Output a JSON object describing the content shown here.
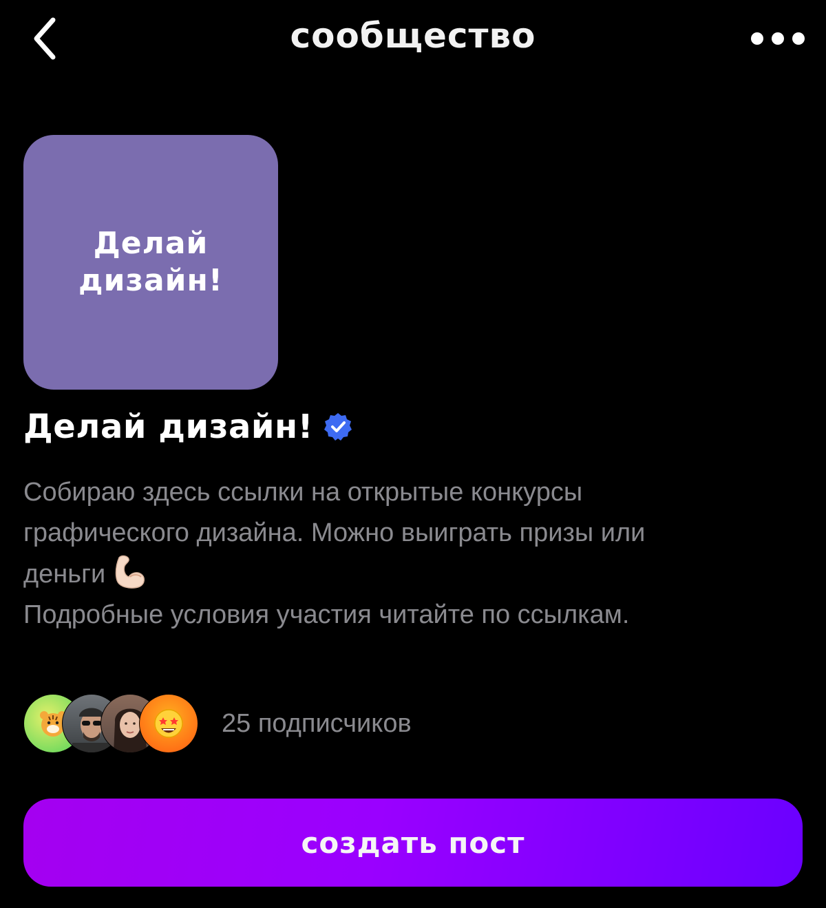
{
  "header": {
    "title": "сообщество",
    "back_icon": "chevron-left-icon",
    "more_icon": "more-dots-icon"
  },
  "community": {
    "cover_text_line1": "Делай",
    "cover_text_line2": "дизайн!",
    "cover_color": "#7b6daf",
    "name": "Делай дизайн!",
    "verified": true,
    "verified_color": "#3e6bf2",
    "description_lines": [
      "Собираю здесь ссылки на открытые конкурсы",
      "графического дизайна. Можно выиграть призы или",
      "деньги",
      "Подробные условия участия читайте по ссылкам."
    ],
    "description_emoji": "flexed-biceps-icon"
  },
  "subscribers": {
    "count_text": "25 подписчиков",
    "avatars": [
      "tiger-avatar",
      "man-sunglasses-avatar",
      "woman-avatar",
      "star-eyes-emoji-avatar"
    ]
  },
  "actions": {
    "create_post_label": "создать пост",
    "accent_start": "#a400f0",
    "accent_end": "#6a00ff"
  }
}
